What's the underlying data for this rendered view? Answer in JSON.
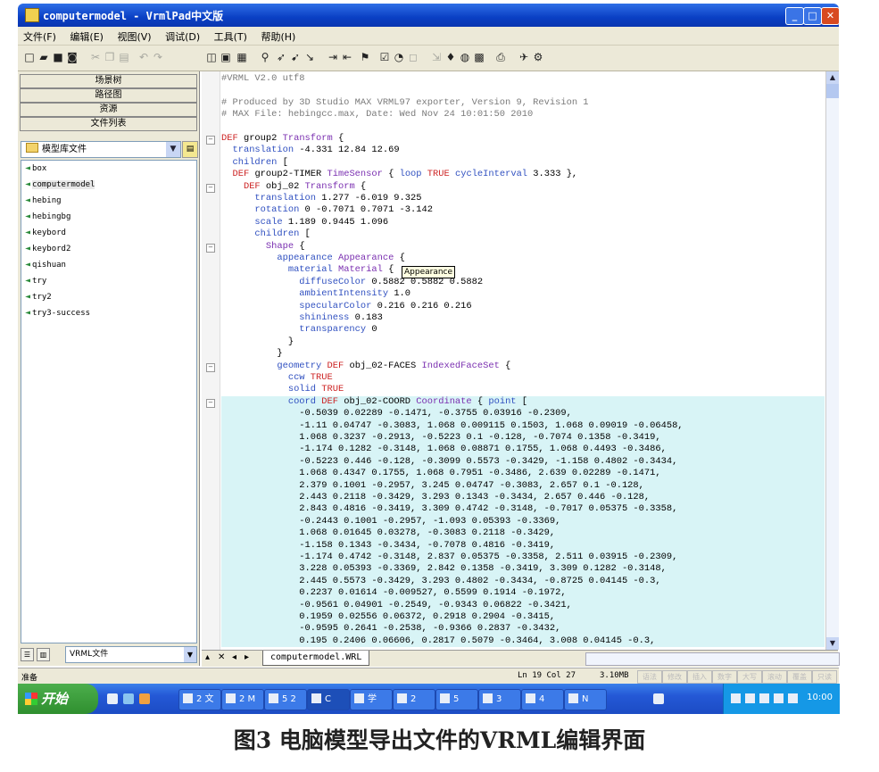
{
  "window": {
    "title": "computermodel - VrmlPad中文版",
    "min": "_",
    "max": "□",
    "close": "✕"
  },
  "menu": [
    "文件(F)",
    "编辑(E)",
    "视图(V)",
    "调试(D)",
    "工具(T)",
    "帮助(H)"
  ],
  "left_panel": {
    "tabs": [
      "场景树",
      "路径图",
      "资源",
      "文件列表"
    ],
    "folder_combo": "模型库文件",
    "files": [
      "box",
      "computermodel",
      "hebing",
      "hebingbg",
      "keybord",
      "keybord2",
      "qishuan",
      "try",
      "try2",
      "try3-success"
    ],
    "selected_file": "computermodel",
    "file_type_combo": "VRML文件"
  },
  "editor": {
    "lines": [
      "#VRML V2.0 utf8",
      "",
      "# Produced by 3D Studio MAX VRML97 exporter, Version 9, Revision 1",
      "# MAX File: hebingcc.max, Date: Wed Nov 24 10:01:50 2010",
      "",
      "DEF group2 Transform {",
      "  translation -4.331 12.84 12.69",
      "  children [",
      "  DEF group2-TIMER TimeSensor { loop TRUE cycleInterval 3.333 },",
      "    DEF obj_02 Transform {",
      "      translation 1.277 -6.019 9.325",
      "      rotation 0 -0.7071 0.7071 -3.142",
      "      scale 1.189 0.9445 1.096",
      "      children [",
      "        Shape {",
      "          appearance Appearance {",
      "            material Material {",
      "              diffuseColor 0.5882 0.5882 0.5882",
      "              ambientIntensity 1.0",
      "              specularColor 0.216 0.216 0.216",
      "              shininess 0.183",
      "              transparency 0",
      "            }",
      "          }",
      "          geometry DEF obj_02-FACES IndexedFaceSet {",
      "            ccw TRUE",
      "            solid TRUE",
      "            coord DEF obj_02-COORD Coordinate { point [",
      "              -0.5039 0.02289 -0.1471, -0.3755 0.03916 -0.2309,",
      "              -1.11 0.04747 -0.3083, 1.068 0.009115 0.1503, 1.068 0.09019 -0.06458,",
      "              1.068 0.3237 -0.2913, -0.5223 0.1 -0.128, -0.7074 0.1358 -0.3419,",
      "              -1.174 0.1282 -0.3148, 1.068 0.08871 0.1755, 1.068 0.4493 -0.3486,",
      "              -0.5223 0.446 -0.128, -0.3099 0.5573 -0.3429, -1.158 0.4802 -0.3434,",
      "              1.068 0.4347 0.1755, 1.068 0.7951 -0.3486, 2.639 0.02289 -0.1471,",
      "              2.379 0.1001 -0.2957, 3.245 0.04747 -0.3083, 2.657 0.1 -0.128,",
      "              2.443 0.2118 -0.3429, 3.293 0.1343 -0.3434, 2.657 0.446 -0.128,",
      "              2.843 0.4816 -0.3419, 3.309 0.4742 -0.3148, -0.7017 0.05375 -0.3358,",
      "              -0.2443 0.1001 -0.2957, -1.093 0.05393 -0.3369,",
      "              1.068 0.01645 0.03278, -0.3083 0.2118 -0.3429,",
      "              -1.158 0.1343 -0.3434, -0.7078 0.4816 -0.3419,",
      "              -1.174 0.4742 -0.3148, 2.837 0.05375 -0.3358, 2.511 0.03915 -0.2309,",
      "              3.228 0.05393 -0.3369, 2.842 0.1358 -0.3419, 3.309 0.1282 -0.3148,",
      "              2.445 0.5573 -0.3429, 3.293 0.4802 -0.3434, -0.8725 0.04145 -0.3,",
      "              0.2237 0.01614 -0.009527, 0.5599 0.1914 -0.1972,",
      "              -0.9561 0.04901 -0.2549, -0.9343 0.06822 -0.3421,",
      "              0.1959 0.02556 0.06372, 0.2918 0.2904 -0.3415,",
      "              -0.9595 0.2641 -0.2538, -0.9366 0.2837 -0.3432,",
      "              0.195 0.2406 0.06606, 0.2817 0.5079 -0.3464, 3.008 0.04145 -0.3,"
    ],
    "tooltip": "Appearance"
  },
  "tab": "computermodel.WRL",
  "status": {
    "left": "准备",
    "position": "Ln 19  Col 27",
    "size": "3.10MB",
    "cells": [
      "语法",
      "修改",
      "插入",
      "数字",
      "大写",
      "滚动",
      "覆盖",
      "只读"
    ]
  },
  "taskbar": {
    "start": "开始",
    "tasks": [
      "2 文",
      "2 M",
      "5 2",
      "C",
      "学",
      "2",
      "5",
      "3",
      "4",
      "N"
    ],
    "clock": "10:00"
  },
  "caption": "图3   电脑模型导出文件的VRML编辑界面"
}
